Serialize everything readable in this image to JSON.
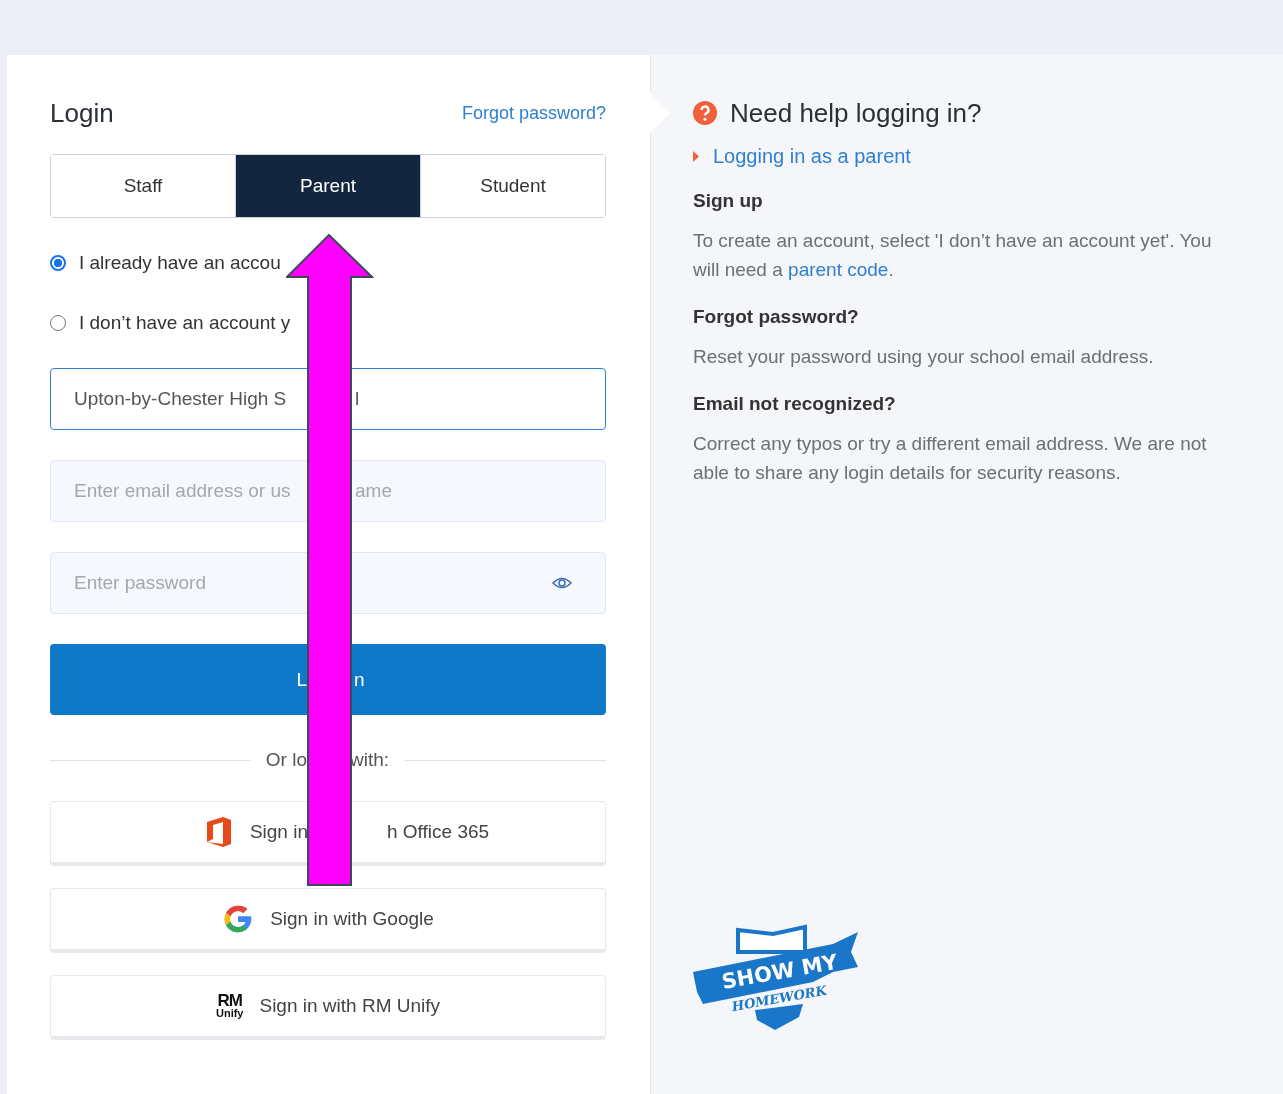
{
  "login": {
    "title": "Login",
    "forgot_link": "Forgot password?",
    "tabs": [
      {
        "label": "Staff",
        "selected": false
      },
      {
        "label": "Parent",
        "selected": true
      },
      {
        "label": "Student",
        "selected": false
      }
    ],
    "account_options": [
      {
        "label": "I already have an accou",
        "selected": true
      },
      {
        "label": "I don’t have an account y",
        "selected": false
      }
    ],
    "school_field": {
      "value": [
        "Upton-by-Chester High S",
        "l"
      ]
    },
    "email_field": {
      "placeholder": [
        "Enter email address or us",
        "ame"
      ]
    },
    "password_field": {
      "placeholder": "Enter password"
    },
    "login_button": [
      "L",
      "n"
    ],
    "divider": [
      "Or lo",
      "with:"
    ],
    "sso_buttons": [
      {
        "kind": "office",
        "label": [
          "Sign in",
          "h Office 365"
        ]
      },
      {
        "kind": "google",
        "label": [
          "Sign in with Google"
        ]
      },
      {
        "kind": "rm",
        "label": [
          "Sign in with RM Unify"
        ],
        "icon_text": [
          "RM",
          "Unify"
        ]
      }
    ]
  },
  "help": {
    "title": "Need help logging in?",
    "link": "Logging in as a parent",
    "sections": [
      {
        "heading": "Sign up",
        "text": "To create an account, select 'I don’t have an account yet'. You will need a ",
        "link": "parent code",
        "text_after": "."
      },
      {
        "heading": "Forgot password?",
        "text": "Reset your password using your school email address."
      },
      {
        "heading": "Email not recognized?",
        "text": "Correct any typos or try a different email address. We are not able to share any login details for security reasons."
      }
    ],
    "logo": [
      "SHOW MY",
      "HOMEWORK"
    ]
  }
}
